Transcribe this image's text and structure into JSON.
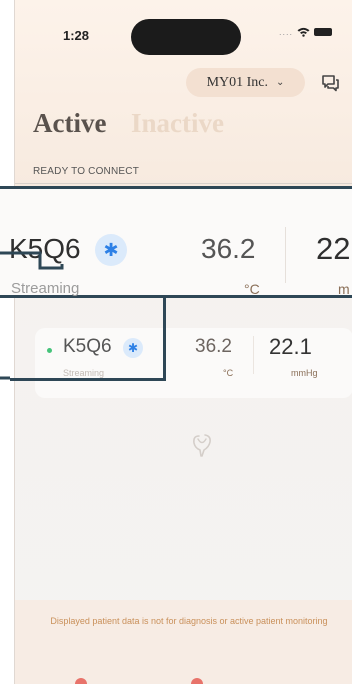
{
  "status_bar": {
    "time": "1:28",
    "signal": "...."
  },
  "header": {
    "org_name": "MY01 Inc.",
    "org_chevron": "⌄"
  },
  "tabs": [
    {
      "label": "Active"
    },
    {
      "label": "Inactive"
    }
  ],
  "section": {
    "label": "READY TO CONNECT"
  },
  "device": {
    "name": "K5Q6",
    "status": "Streaming",
    "temperature": "36.2",
    "temperature_unit": "°C",
    "pressure": "22.1",
    "pressure_unit": "mmHg",
    "status_color": "#45c37a"
  },
  "zoom": {
    "name": "K5Q6",
    "status": "Streaming",
    "temperature": "36.2",
    "temperature_unit": "°C",
    "pressure": "22",
    "pressure_unit": "m"
  },
  "icons": {
    "bluetooth": "bluetooth-icon",
    "chat": "chat-icon",
    "empty": "logo-icon"
  },
  "footer": {
    "disclaimer": "Displayed patient data is not for diagnosis or active patient monitoring"
  },
  "colors": {
    "accent": "#2e4756",
    "bluetooth": "#2d80e6",
    "warning_text": "#c9905a"
  }
}
